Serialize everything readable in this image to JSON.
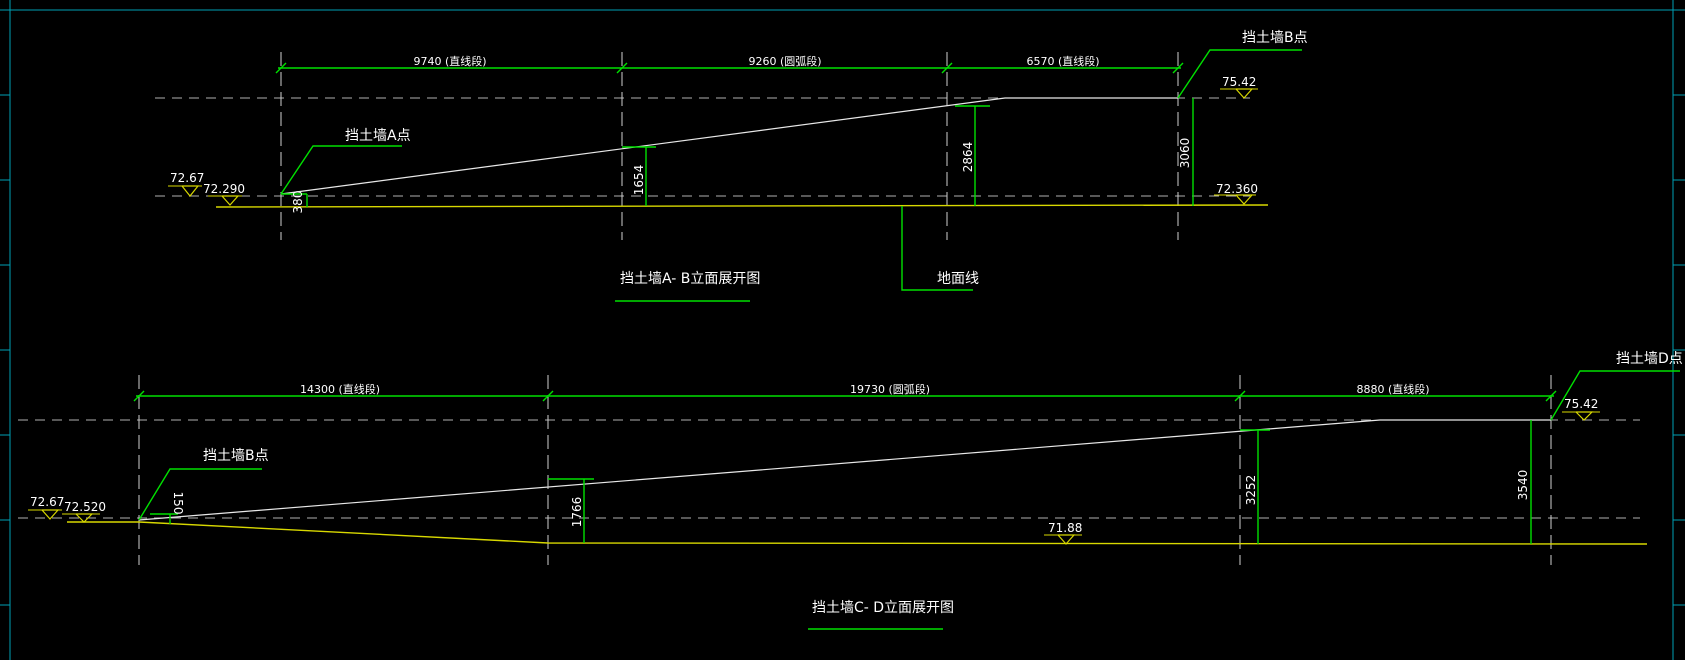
{
  "colors": {
    "background": "#000000",
    "frame": "#00a0b4",
    "dimension": "#00e000",
    "text": "#ffffff",
    "ground": "#d8d800",
    "slope": "#e8e8e8",
    "dashed": "#b0b0b0"
  },
  "elevation_ab": {
    "title": "挡土墙A- B立面展开图",
    "point_a": "挡土墙A点",
    "point_b": "挡土墙B点",
    "ground_label": "地面线",
    "dims_top": [
      "9740 (直线段)",
      "9260 (圆弧段)",
      "6570 (直线段)"
    ],
    "heights": [
      "380",
      "1654",
      "2864",
      "3060"
    ],
    "elev_left_top": "72.67",
    "elev_left_bottom": "72.290",
    "elev_right_top": "75.42",
    "elev_right_bottom": "72.360"
  },
  "elevation_cd": {
    "title": "挡土墙C- D立面展开图",
    "point_b": "挡土墙B点",
    "point_d": "挡土墙D点",
    "dims_top": [
      "14300 (直线段)",
      "19730 (圆弧段)",
      "8880 (直线段)"
    ],
    "heights": [
      "150",
      "1766",
      "3252",
      "3540"
    ],
    "elev_left_top": "72.67",
    "elev_left_bottom": "72.520",
    "elev_right_top": "75.42",
    "elev_ground_mid": "71.88"
  }
}
